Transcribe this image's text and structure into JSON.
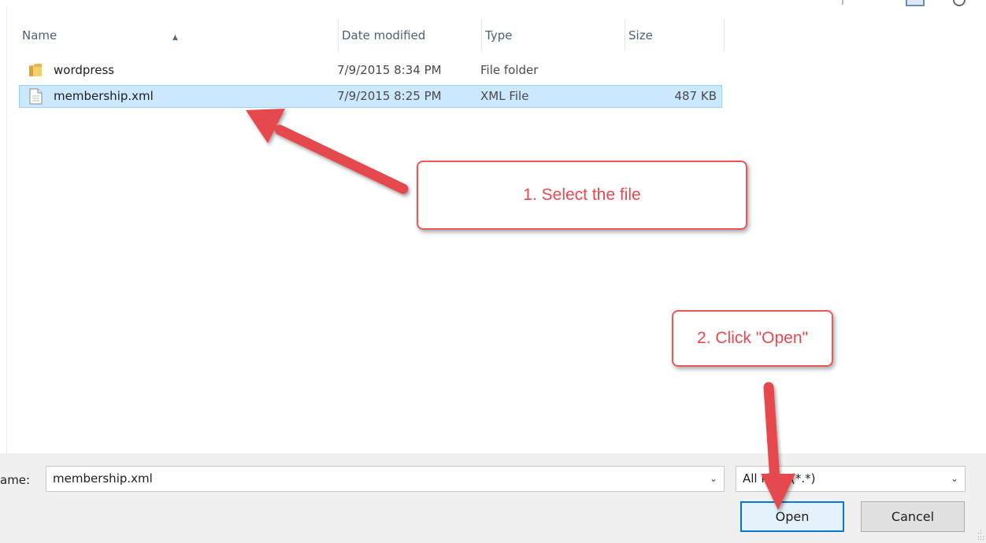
{
  "columns": {
    "name": "Name",
    "date_modified": "Date modified",
    "type": "Type",
    "size": "Size"
  },
  "files": [
    {
      "name": "wordpress",
      "date_modified": "7/9/2015 8:34 PM",
      "type": "File folder",
      "size": "",
      "icon": "folder-icon",
      "selected": false
    },
    {
      "name": "membership.xml",
      "date_modified": "7/9/2015 8:25 PM",
      "type": "XML File",
      "size": "487 KB",
      "icon": "document-icon",
      "selected": true
    }
  ],
  "footer": {
    "file_name_label": "ame:",
    "file_name_value": "membership.xml",
    "file_type_value": "All Files (*.*)",
    "open_label": "Open",
    "cancel_label": "Cancel"
  },
  "annotations": {
    "step1": "1. Select the file",
    "step2": "2. Click \"Open\""
  },
  "colors": {
    "selection": "#cce8ff",
    "selection_border": "#99d1ff",
    "annotation": "#e8484f",
    "header_text": "#4c607a"
  }
}
